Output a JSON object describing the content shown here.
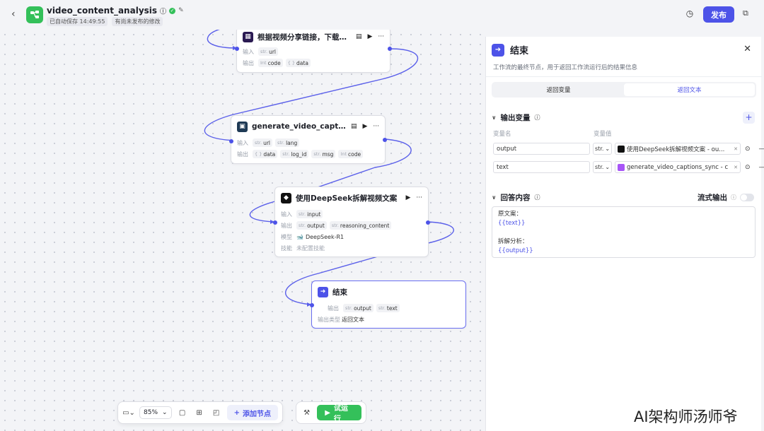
{
  "header": {
    "title": "video_content_analysis",
    "autosave": "已自动保存 14:49:55",
    "unpublished": "有尚未发布的修改",
    "publish_label": "发布"
  },
  "nodes": {
    "download": {
      "title": "根据视频分享链接，下载视频",
      "input_label": "输入",
      "output_label": "输出",
      "inputs": [
        {
          "type": "str.",
          "name": "url"
        }
      ],
      "outputs": [
        {
          "type": "Int",
          "name": "code"
        },
        {
          "type": "{ }",
          "name": "data"
        }
      ]
    },
    "captions": {
      "title": "generate_video_captions_s...",
      "input_label": "输入",
      "output_label": "输出",
      "inputs": [
        {
          "type": "str.",
          "name": "url"
        },
        {
          "type": "str.",
          "name": "lang"
        }
      ],
      "outputs": [
        {
          "type": "{ }",
          "name": "data"
        },
        {
          "type": "str.",
          "name": "log_id"
        },
        {
          "type": "str.",
          "name": "msg"
        },
        {
          "type": "Int",
          "name": "code"
        }
      ]
    },
    "deepseek": {
      "title": "使用DeepSeek拆解视频文案",
      "input_label": "输入",
      "output_label": "输出",
      "model_label": "模型",
      "skill_label": "技能",
      "inputs": [
        {
          "type": "str.",
          "name": "input"
        }
      ],
      "outputs": [
        {
          "type": "str.",
          "name": "output"
        },
        {
          "type": "str.",
          "name": "reasoning_content"
        }
      ],
      "model": "DeepSeek-R1",
      "skill": "未配置技能"
    },
    "end": {
      "title": "结束",
      "output_label": "输出",
      "output_type_label": "输出类型",
      "outputs": [
        {
          "type": "str.",
          "name": "output"
        },
        {
          "type": "str.",
          "name": "text"
        }
      ],
      "output_type": "返回文本"
    }
  },
  "toolbar": {
    "zoom": "85%",
    "add_node": "添加节点",
    "run": "试运行"
  },
  "panel": {
    "title": "结束",
    "description": "工作流的最终节点，用于返回工作流运行后的结果信息",
    "tabs": [
      "返回变量",
      "返回文本"
    ],
    "active_tab": 1,
    "output_vars_title": "输出变量",
    "col_name": "变量名",
    "col_value": "变量值",
    "vars": [
      {
        "name": "output",
        "type": "str.",
        "ref": "使用DeepSeek拆解视频文案 - ou..."
      },
      {
        "name": "text",
        "type": "str.",
        "ref": "generate_video_captions_sync - c"
      }
    ],
    "answer_title": "回答内容",
    "stream_label": "流式输出",
    "answer_lines": [
      "原文案：",
      "{{text}}",
      "",
      "拆解分析：",
      "{{output}}"
    ]
  },
  "watermark": "AI架构师汤师爷",
  "colors": {
    "accent": "#4d53e8",
    "run_green": "#34c05a"
  }
}
